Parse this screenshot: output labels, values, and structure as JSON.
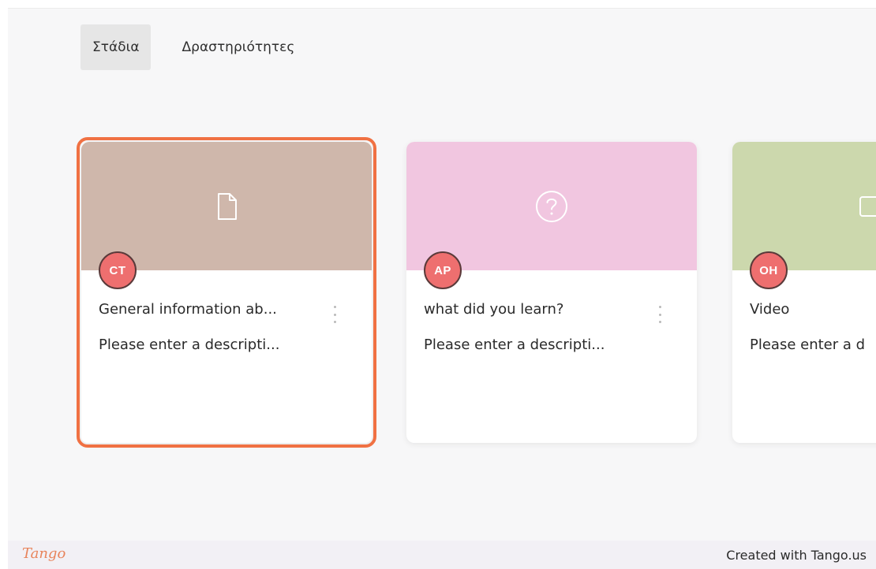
{
  "tabs": [
    {
      "label": "Στάδια",
      "active": true
    },
    {
      "label": "Δραστηριότητες",
      "active": false
    }
  ],
  "cards": [
    {
      "initials": "CT",
      "title": "General information ab...",
      "description": "Please enter a descripti...",
      "banner_color": "#cfb7ab",
      "icon": "document-icon",
      "selected": true
    },
    {
      "initials": "AP",
      "title": "what did you learn?",
      "description": "Please enter a descripti...",
      "banner_color": "#f1c6e0",
      "icon": "question-icon",
      "selected": false
    },
    {
      "initials": "OH",
      "title": "Video",
      "description": "Please enter a d",
      "banner_color": "#ccd8ad",
      "icon": "video-icon",
      "selected": false
    }
  ],
  "colors": {
    "highlight": "#f07143",
    "avatar": "#ee6f6f"
  },
  "footer": {
    "logo": "Tango",
    "credit": "Created with Tango.us"
  }
}
